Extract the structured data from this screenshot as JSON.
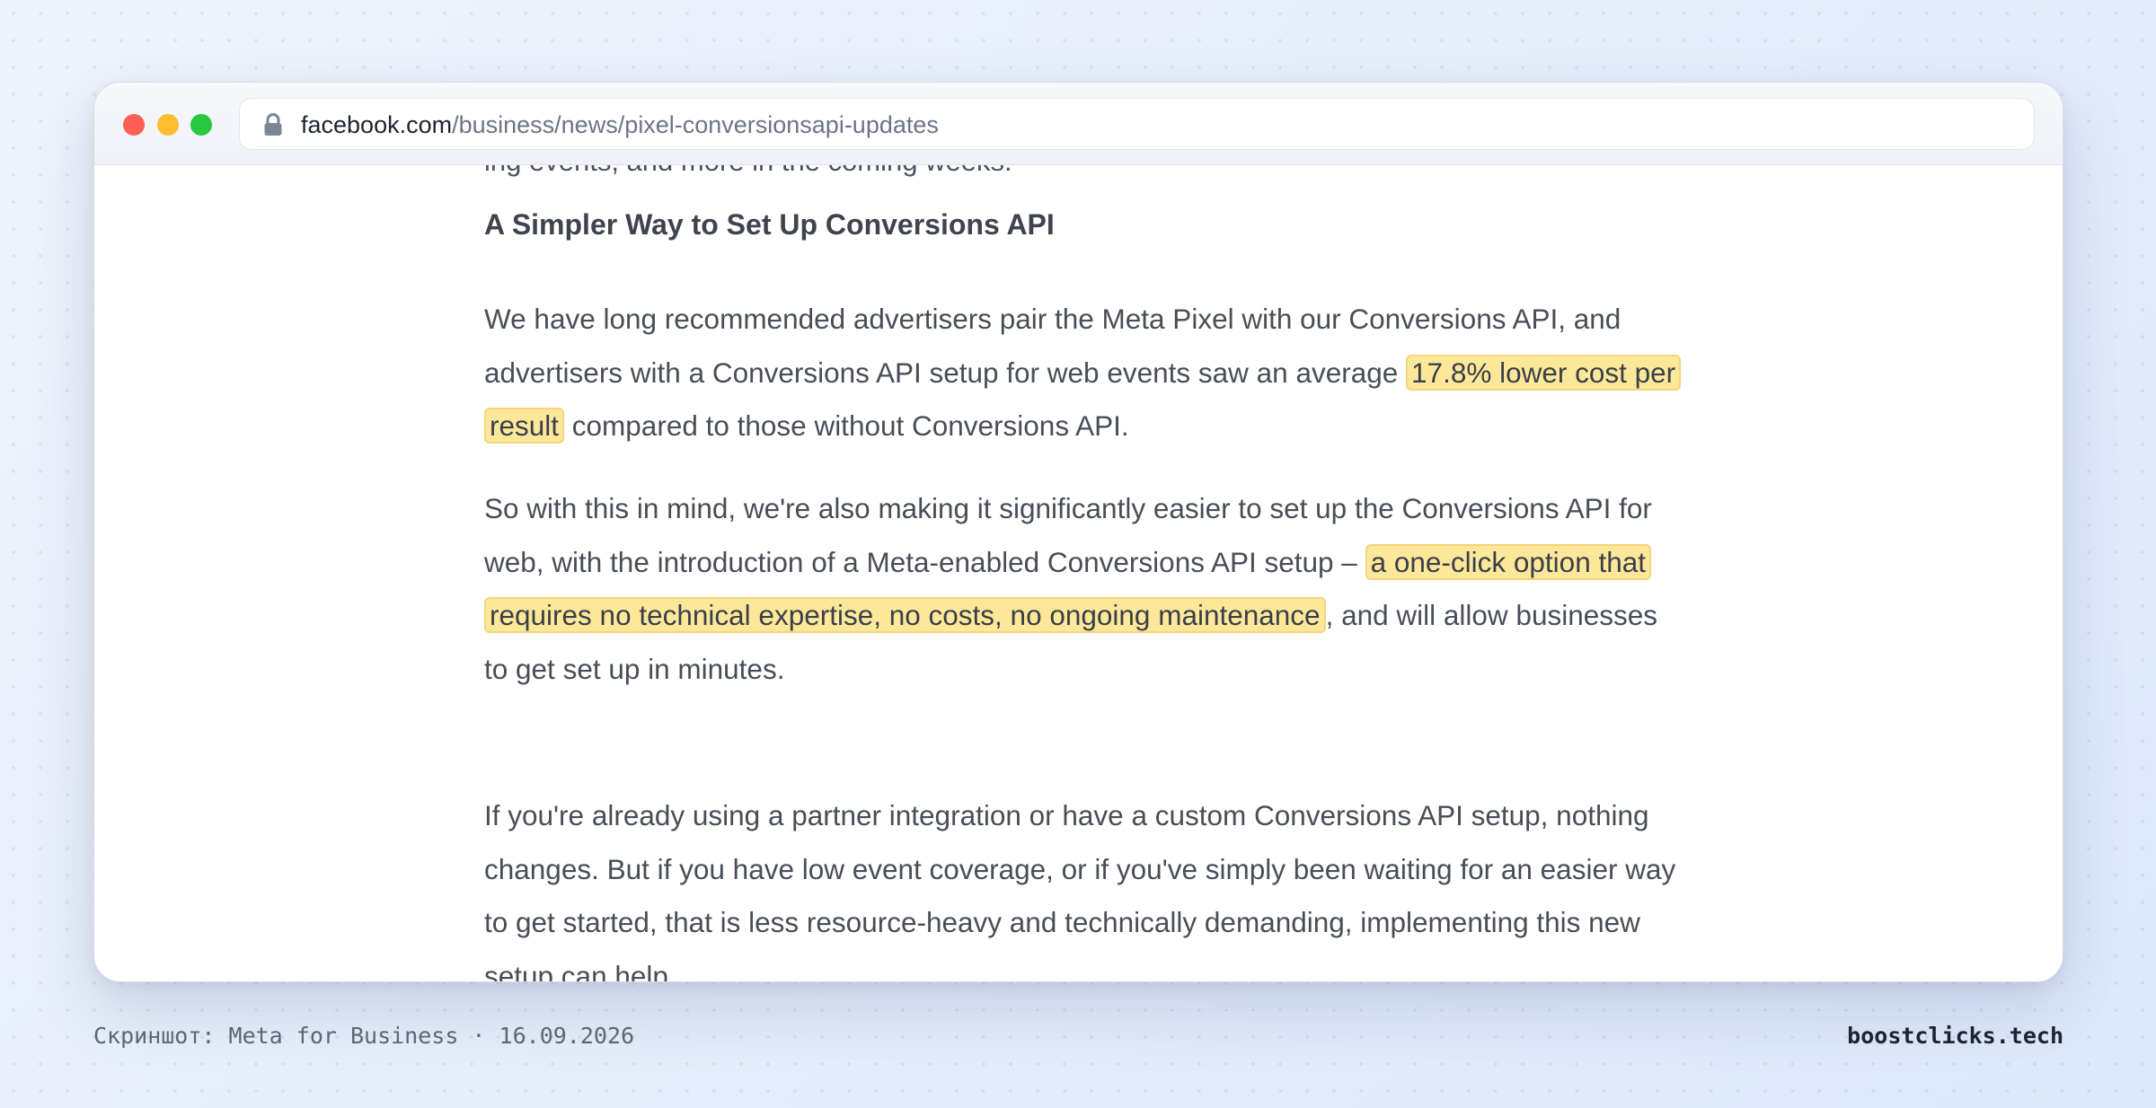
{
  "browser": {
    "url_host": "facebook.com",
    "url_path": "/business/news/pixel-conversionsapi-updates",
    "icons": [
      "close-light",
      "minimize-light",
      "maximize-light",
      "lock-icon"
    ]
  },
  "article": {
    "cut_line": "ing events, and more in the coming weeks.",
    "heading": "A Simpler Way to Set Up Conversions API",
    "p1": {
      "before": "We have long recommended advertisers pair the Meta Pixel with our Conversions API, and advertisers with a Conversions API setup for web events saw an average ",
      "highlight": "17.8% lower cost per result",
      "after": " compared to those without Conversions API."
    },
    "p2": {
      "before": "So with this in mind, we're also making it significantly easier to set up the Conversions API for web, with the introduction of a Meta-enabled Conversions API setup – ",
      "highlight": "a one-click option that requires no technical expertise, no costs, no ongoing maintenance",
      "after": ", and will allow businesses to get set up in minutes."
    },
    "p3": "If you're already using a partner integration or have a custom Conversions API setup, nothing changes. But if you have low event coverage, or if you've simply been waiting for an easier way to get started, that is less resource-heavy and technically demanding, implementing this new setup can help."
  },
  "footer": {
    "caption": "Скриншот: Meta for Business · 16.09.2026",
    "brand": "boostclicks.tech"
  },
  "colors": {
    "highlight_fill": "#fde89a",
    "highlight_border": "#f4d57a",
    "close": "#ff5f57",
    "minimize": "#febc2e",
    "maximize": "#28c840"
  }
}
